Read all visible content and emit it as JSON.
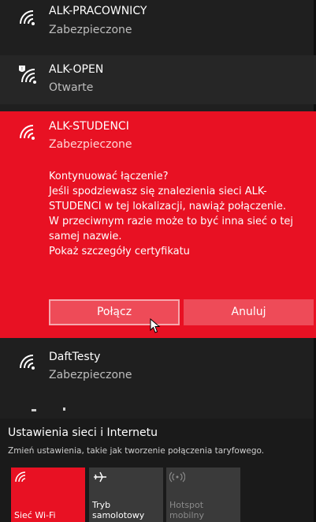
{
  "networks": [
    {
      "ssid": "ALK-PRACOWNICY",
      "state": "Zabezpieczone"
    },
    {
      "ssid": "ALK-OPEN",
      "state": "Otwarte"
    },
    {
      "ssid": "ALK-STUDENCI",
      "state": "Zabezpieczone"
    },
    {
      "ssid": "DaftTesty",
      "state": "Zabezpieczone"
    }
  ],
  "prompt": {
    "lines": [
      "Kontynuować łączenie?",
      "Jeśli spodziewasz się znalezienia sieci ALK-",
      "STUDENCI w tej lokalizacji, nawiąż połączenie.",
      "W przeciwnym razie może to być inna sieć o tej",
      "samej nazwie."
    ],
    "cert_link": "Pokaż szczegóły certyfikatu"
  },
  "buttons": {
    "connect": "Połącz",
    "cancel": "Anuluj"
  },
  "settings": {
    "title": "Ustawienia sieci i Internetu",
    "subtitle": "Zmień ustawienia, takie jak tworzenie połączenia taryfowego."
  },
  "tiles": [
    {
      "line1": "Sieć Wi-Fi",
      "line2": ""
    },
    {
      "line1": "Tryb",
      "line2": "samolotowy"
    },
    {
      "line1": "Hotspot",
      "line2": "mobilny"
    }
  ],
  "colors": {
    "accent": "#e81123",
    "background": "#1f1f1f"
  }
}
